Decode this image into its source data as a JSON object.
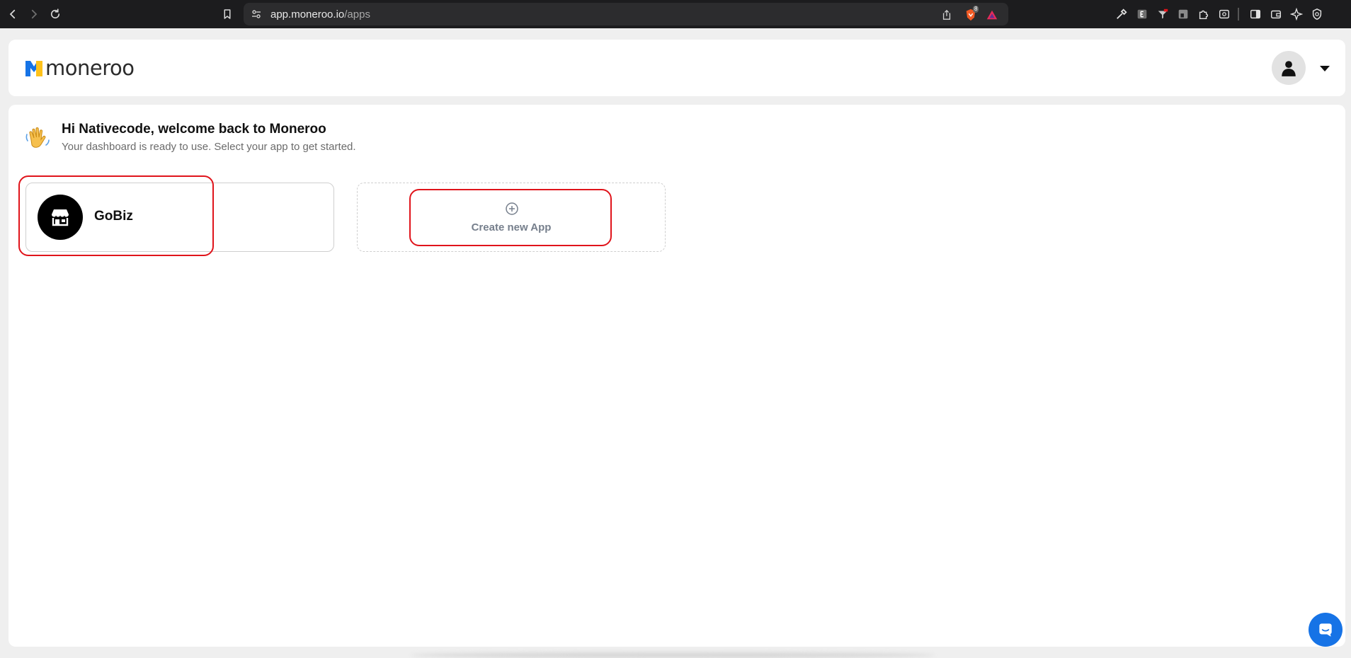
{
  "browser": {
    "url_host": "app.moneroo.io",
    "url_path": "/apps",
    "shield_badge": "8"
  },
  "header": {
    "logo_text": "moneroo"
  },
  "welcome": {
    "title": "Hi Nativecode, welcome back to Moneroo",
    "subtitle": "Your dashboard is ready to use. Select your app to get started."
  },
  "apps": [
    {
      "name": "GoBiz"
    }
  ],
  "create_app": {
    "label": "Create new App"
  },
  "colors": {
    "brand_blue": "#1673e6",
    "brand_yellow": "#ffc21a",
    "highlight": "#e0141b"
  }
}
